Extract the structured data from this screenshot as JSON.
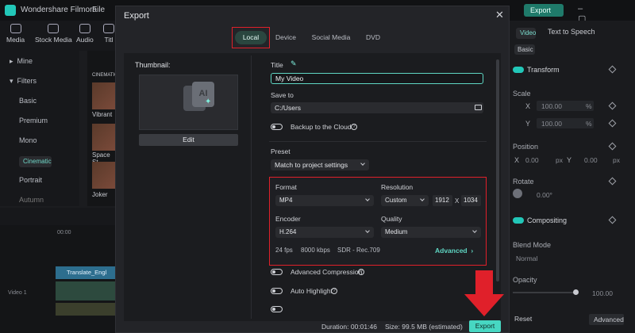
{
  "app": {
    "title": "Wondershare Filmora",
    "menu_file": "File",
    "top_export": "Export",
    "win_controls": "– ▢ ✕"
  },
  "library": {
    "toolbar": [
      "Media",
      "Stock Media",
      "Audio",
      "Titl"
    ],
    "side_items": [
      {
        "label": "Mine",
        "prefix": "▸"
      },
      {
        "label": "Filters",
        "prefix": "▾"
      },
      {
        "label": "Basic"
      },
      {
        "label": "Premium"
      },
      {
        "label": "Mono"
      },
      {
        "label": "Cinematic"
      },
      {
        "label": "Portrait"
      },
      {
        "label": "Autumn"
      }
    ],
    "thumbs": [
      "CINEMATIC",
      "Vibrant",
      "Space St",
      "Joker"
    ]
  },
  "timeline": {
    "clip_label": "Translate_Engl",
    "ruler": "00:00",
    "track_label": "Video 1"
  },
  "right_panel": {
    "tabs": [
      "Video",
      "Text to Speech"
    ],
    "basic_chip": "Basic",
    "transform": "Transform",
    "scale": "Scale",
    "x_label": "X",
    "x_value": "100.00",
    "y_label": "Y",
    "y_value": "100.00",
    "percent": "%",
    "position": "Position",
    "pos_x": "X",
    "pos_x_val": "0.00",
    "px": "px",
    "pos_y": "Y",
    "pos_y_val": "0.00",
    "rotate": "Rotate",
    "rotate_val": "0.00°",
    "compositing": "Compositing",
    "blend_mode": "Blend Mode",
    "blend_val": "Normal",
    "opacity": "Opacity",
    "opacity_val": "100.00",
    "opacity_level": 1.0,
    "reset": "Reset",
    "advanced": "Advanced"
  },
  "dialog": {
    "title": "Export",
    "close": "✕",
    "tabs": [
      "Local",
      "Device",
      "Social Media",
      "DVD"
    ],
    "thumbnail_label": "Thumbnail:",
    "edit_button": "Edit",
    "title_label": "Title",
    "title_value": "My Video",
    "save_to_label": "Save to",
    "save_path": "C:/Users",
    "backup_label": "Backup to the Cloud",
    "preset_label": "Preset",
    "preset_value": "Match to project settings",
    "format_label": "Format",
    "format_value": "MP4",
    "resolution_label": "Resolution",
    "resolution_value": "Custom",
    "res_w": "1912",
    "res_x": "X",
    "res_h": "1034",
    "encoder_label": "Encoder",
    "encoder_value": "H.264",
    "quality_label": "Quality",
    "quality_value": "Medium",
    "fps": "24 fps",
    "bitrate": "8000 kbps",
    "color": "SDR - Rec.709",
    "advanced_link": "Advanced",
    "adv_compression": "Advanced Compression",
    "auto_highlight": "Auto Highlight",
    "duration": "Duration: 00:01:46",
    "size": "Size: 99.5 MB (estimated)",
    "export_button": "Export"
  },
  "colors": {
    "accent": "#47d7c2",
    "highlight": "#e0202a",
    "dialog_bg": "#232428"
  }
}
